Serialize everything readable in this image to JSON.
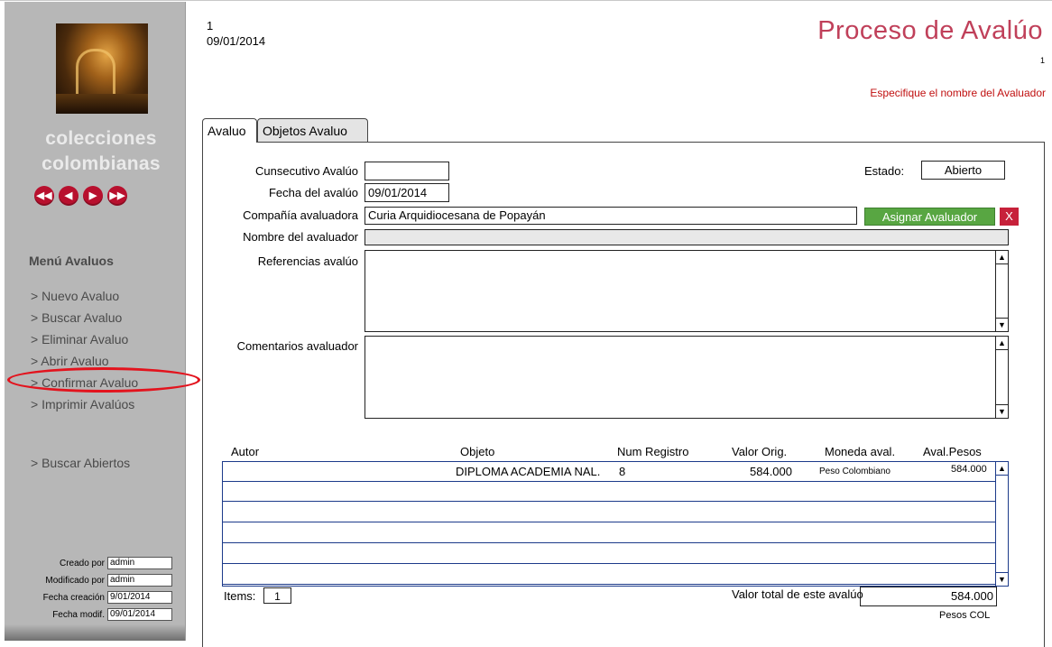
{
  "sidebar": {
    "brand_line1": "colecciones",
    "brand_line2": "colombianas",
    "nav": [
      "◀◀",
      "◀",
      "▶",
      "▶▶"
    ],
    "menu_title": "Menú Avaluos",
    "items": [
      "> Nuevo Avaluo",
      "> Buscar Avaluo",
      "> Eliminar Avaluo",
      "> Abrir Avaluo",
      "> Confirmar Avaluo",
      "> Imprimir Avalúos",
      "> Buscar Abiertos"
    ],
    "meta": [
      {
        "label": "Creado por",
        "value": "admin"
      },
      {
        "label": "Modificado por",
        "value": "admin"
      },
      {
        "label": "Fecha creación",
        "value": "9/01/2014"
      },
      {
        "label": "Fecha modif.",
        "value": "09/01/2014"
      }
    ]
  },
  "header": {
    "record_number": "1",
    "date": "09/01/2014",
    "title": "Proceso de Avalúo",
    "page_number": "1",
    "warning": "Especifique el nombre del Avaluador"
  },
  "tabs": [
    "Avaluo",
    "Objetos Avaluo"
  ],
  "form": {
    "consecutivo_label": "Cunsecutivo Avalúo",
    "consecutivo_value": "",
    "fecha_label": "Fecha del avalúo",
    "fecha_value": "09/01/2014",
    "compania_label": "Compañía avaluadora",
    "compania_value": "Curia Arquidiocesana de Popayán",
    "nombre_label": "Nombre del avaluador",
    "nombre_value": "",
    "referencias_label": "Referencias avalúo",
    "comentarios_label": "Comentarios avaluador",
    "estado_label": "Estado:",
    "estado_value": "Abierto",
    "assign_button": "Asignar Avaluador",
    "clear_button": "X"
  },
  "table": {
    "columns": [
      "Autor",
      "Objeto",
      "Num Registro",
      "Valor Orig.",
      "Moneda aval.",
      "Aval.Pesos"
    ],
    "rows": [
      {
        "autor": "",
        "objeto": "DIPLOMA ACADEMIA NAL.",
        "num": "8",
        "valor": "584.000",
        "moneda": "Peso Colombiano",
        "pesos": "584.000"
      }
    ]
  },
  "footer": {
    "items_label": "Items:",
    "items_value": "1",
    "total_label": "Valor total de este avalúo",
    "total_value": "584.000",
    "currency_label": "Pesos COL"
  },
  "colors": {
    "accent_title": "#c0405a",
    "warning": "#c01010",
    "assign_button": "#58a642",
    "clear_button": "#c7213a",
    "nav_buttons": "#b8102e",
    "sidebar": "#b7b7b7",
    "grid_lines": "#1c3a8a",
    "highlight_ring": "#e3131d"
  }
}
